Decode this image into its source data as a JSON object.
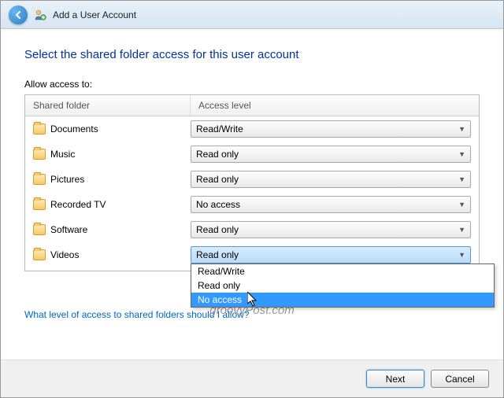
{
  "titlebar": {
    "title": "Add a User Account"
  },
  "heading": "Select the shared folder access for this user account",
  "subheading": "Allow access to:",
  "columns": {
    "folder": "Shared folder",
    "level": "Access level"
  },
  "rows": [
    {
      "folder": "Documents",
      "level": "Read/Write"
    },
    {
      "folder": "Music",
      "level": "Read only"
    },
    {
      "folder": "Pictures",
      "level": "Read only"
    },
    {
      "folder": "Recorded TV",
      "level": "No access"
    },
    {
      "folder": "Software",
      "level": "Read only"
    },
    {
      "folder": "Videos",
      "level": "Read only"
    }
  ],
  "dropdown": {
    "options": [
      "Read/Write",
      "Read only",
      "No access"
    ],
    "highlighted": "No access"
  },
  "help_link": "What level of access to shared folders should I allow?",
  "buttons": {
    "next": "Next",
    "cancel": "Cancel"
  },
  "watermark": "groovyPost.com"
}
